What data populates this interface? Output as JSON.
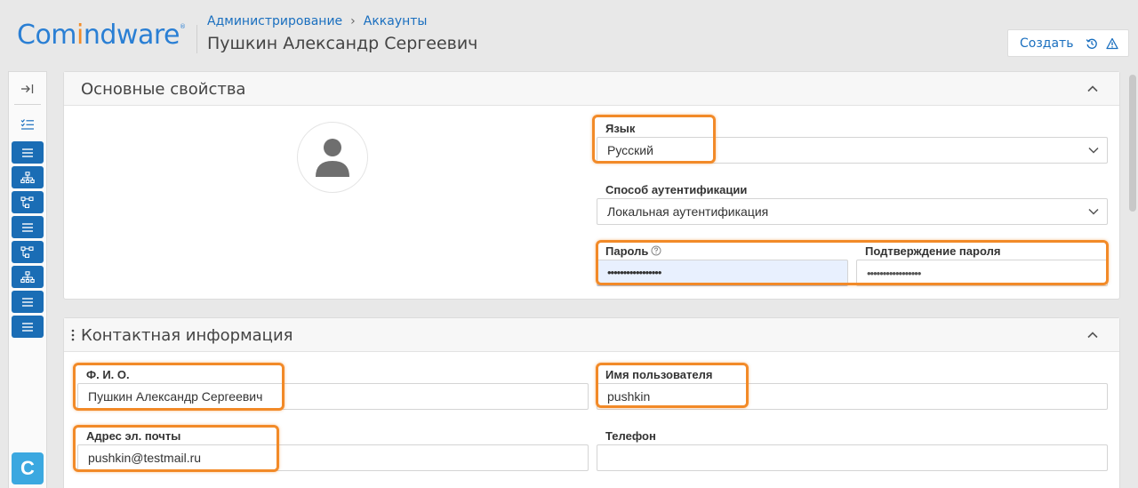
{
  "app": {
    "logo_left": "Com",
    "logo_o": "i",
    "logo_right": "ndware",
    "logo_mark": "®"
  },
  "breadcrumb": {
    "item1": "Администрирование",
    "separator": "›",
    "item2": "Аккаунты"
  },
  "page_title": "Пушкин Александр Сергеевич",
  "toolbar": {
    "create_label": "Создать",
    "history_icon": "history-icon",
    "warning_icon": "warning-icon"
  },
  "sidebar": {
    "items": [
      "expand-icon",
      "checklist-icon",
      "list-icon",
      "org-chart-icon",
      "workflow-icon",
      "list-icon",
      "workflow-icon",
      "org-chart-icon",
      "list-icon",
      "list-icon"
    ],
    "bottom_badge": "C"
  },
  "section_main": {
    "title": "Основные свойства",
    "language_label": "Язык",
    "language_value": "Русский",
    "auth_label": "Способ аутентификации",
    "auth_value": "Локальная аутентификация",
    "password_label": "Пароль",
    "password_value": "•••••••••••••••••",
    "password_confirm_label": "Подтверждение пароля",
    "password_confirm_value": "•••••••••••••••••"
  },
  "section_contact": {
    "title": "Контактная информация",
    "fio_label": "Ф. И. О.",
    "fio_value": "Пушкин Александр Сергеевич",
    "username_label": "Имя пользователя",
    "username_value": "pushkin",
    "email_label": "Адрес эл. почты",
    "email_value": "pushkin@testmail.ru",
    "phone_label": "Телефон",
    "phone_value": ""
  },
  "colors": {
    "accent": "#1a6fbf",
    "highlight": "#f28a28",
    "sidebar_button": "#1a6db5",
    "badge": "#3ba8e0"
  }
}
